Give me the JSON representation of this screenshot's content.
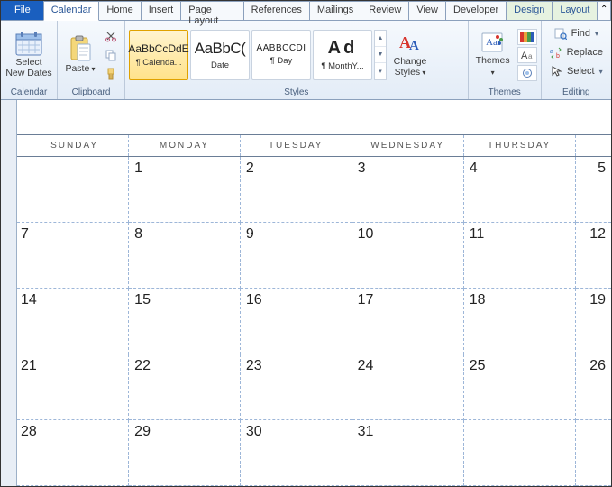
{
  "tabs": {
    "file": "File",
    "calendar": "Calendar",
    "home": "Home",
    "insert": "Insert",
    "page_layout": "Page Layout",
    "references": "References",
    "mailings": "Mailings",
    "review": "Review",
    "view": "View",
    "developer": "Developer",
    "design": "Design",
    "layout": "Layout"
  },
  "ribbon": {
    "calendar": {
      "select_dates_l1": "Select",
      "select_dates_l2": "New Dates",
      "label": "Calendar"
    },
    "clipboard": {
      "paste": "Paste",
      "label": "Clipboard"
    },
    "styles": {
      "items": [
        {
          "sample": "AaBbCcDdE",
          "name": "¶ Calenda..."
        },
        {
          "sample": "AaBbC(",
          "name": "Date"
        },
        {
          "sample": "AABBCCDI",
          "name": "¶ Day"
        },
        {
          "sample": "Ad",
          "name": "¶ MonthY..."
        }
      ],
      "change_styles": "Change\nStyles",
      "label": "Styles"
    },
    "themes": {
      "themes": "Themes",
      "label": "Themes"
    },
    "editing": {
      "find": "Find",
      "replace": "Replace",
      "select": "Select",
      "label": "Editing"
    }
  },
  "calendar_grid": {
    "headers": [
      "SUNDAY",
      "MONDAY",
      "TUESDAY",
      "WEDNESDAY",
      "THURSDAY",
      ""
    ],
    "rows": [
      [
        "",
        "1",
        "2",
        "3",
        "4",
        "5"
      ],
      [
        "7",
        "8",
        "9",
        "10",
        "11",
        "12"
      ],
      [
        "14",
        "15",
        "16",
        "17",
        "18",
        "19"
      ],
      [
        "21",
        "22",
        "23",
        "24",
        "25",
        "26"
      ],
      [
        "28",
        "29",
        "30",
        "31",
        "",
        ""
      ]
    ]
  }
}
